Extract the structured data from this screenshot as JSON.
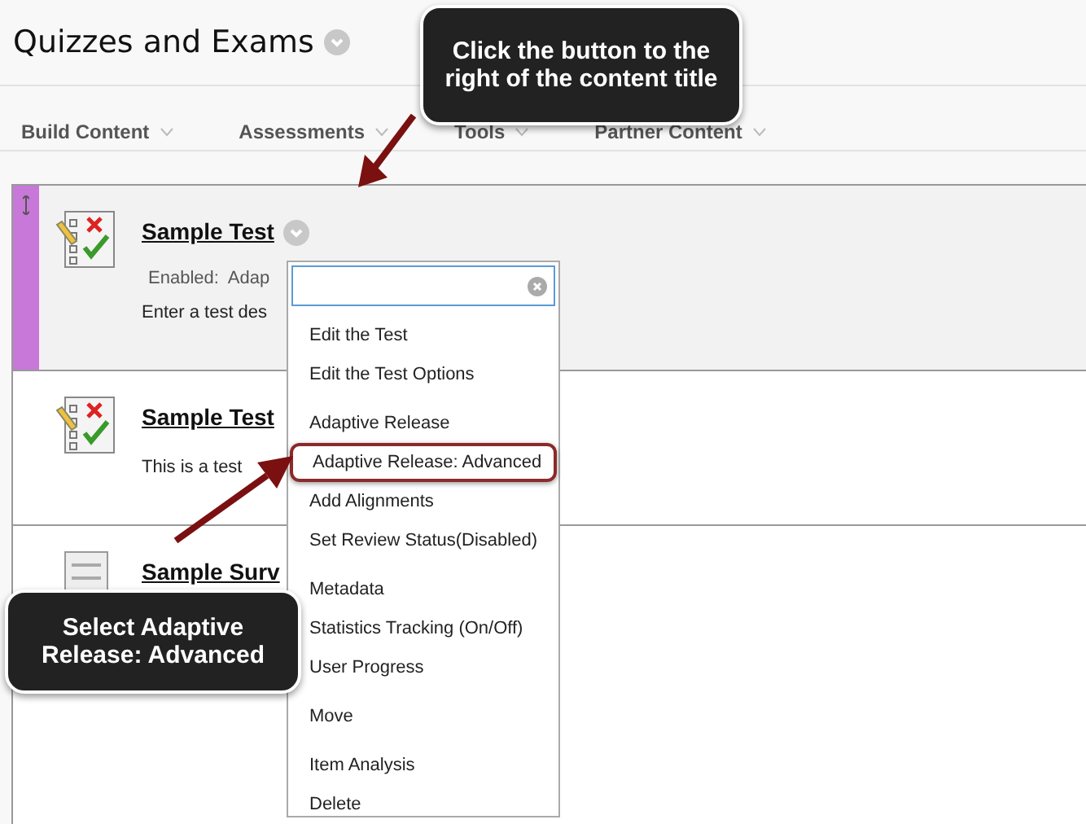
{
  "page_title": "Quizzes and Exams",
  "nav": [
    {
      "label": "Build Content"
    },
    {
      "label": "Assessments"
    },
    {
      "label": "Tools"
    },
    {
      "label": "Partner Content"
    }
  ],
  "items": [
    {
      "kind": "test",
      "title": "Sample Test",
      "selected": true,
      "meta": "Enabled:  Adap",
      "description": "Enter a test des"
    },
    {
      "kind": "test",
      "title": "Sample Test",
      "selected": false,
      "description": "This is a test"
    },
    {
      "kind": "survey",
      "title": "Sample Surv",
      "selected": false
    }
  ],
  "menu": {
    "groups": [
      [
        {
          "label": "Edit the Test",
          "highlighted": false
        },
        {
          "label": "Edit the Test Options",
          "highlighted": false
        }
      ],
      [
        {
          "label": "Adaptive Release",
          "highlighted": false
        },
        {
          "label": "Adaptive Release: Advanced",
          "highlighted": true
        },
        {
          "label": "Add Alignments",
          "highlighted": false
        },
        {
          "label": "Set Review Status(Disabled)",
          "highlighted": false
        }
      ],
      [
        {
          "label": "Metadata",
          "highlighted": false
        },
        {
          "label": "Statistics Tracking (On/Off)",
          "highlighted": false
        },
        {
          "label": "User Progress",
          "highlighted": false
        }
      ],
      [
        {
          "label": "Move",
          "highlighted": false
        }
      ],
      [
        {
          "label": "Item Analysis",
          "highlighted": false
        },
        {
          "label": "Delete",
          "highlighted": false
        }
      ]
    ]
  },
  "callouts": [
    {
      "text": "Click the button to the right of the content title"
    },
    {
      "text": "Select Adaptive Release: Advanced"
    }
  ]
}
